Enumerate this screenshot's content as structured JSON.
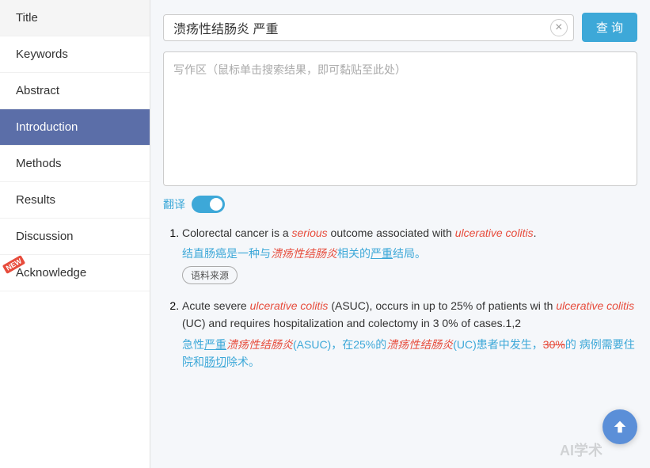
{
  "sidebar": {
    "items": [
      {
        "label": "Title",
        "active": false
      },
      {
        "label": "Keywords",
        "active": false
      },
      {
        "label": "Abstract",
        "active": false
      },
      {
        "label": "Introduction",
        "active": true
      },
      {
        "label": "Methods",
        "active": false
      },
      {
        "label": "Results",
        "active": false
      },
      {
        "label": "Discussion",
        "active": false
      },
      {
        "label": "Acknowledge",
        "active": false,
        "new": true
      }
    ]
  },
  "search": {
    "value": "溃疡性结肠炎 严重",
    "clear_label": "×",
    "button_label": "查 询"
  },
  "writing_area": {
    "placeholder": "写作区（鼠标单击搜索结果，即可黏贴至此处）"
  },
  "translate": {
    "label": "翻译"
  },
  "results": [
    {
      "en": "Colorectal cancer is a serious outcome associated with ulcerative colitis.",
      "en_italic1": "serious",
      "en_italic2": "ulcerative colitis",
      "zh": "结直肠癌是一种与溃疡性结肠炎相关的严重结局。",
      "zh_italic": "溃疡性结肠炎",
      "source": "语料来源"
    },
    {
      "en": "Acute severe ulcerative colitis (ASUC), occurs in up to 25% of patients with ulcerative colitis (UC) and requires hospitalization and colectomy in 30% of cases.1,2",
      "en_italic1": "ulcerative colitis",
      "en_italic2": "ulcerative colitis",
      "zh": "急性严重溃疡性结肠炎(ASUC)，在25%的溃疡性结肠炎(UC)患者中发生，30%的病例需要住院和肠切除术。",
      "source": null
    }
  ],
  "watermark": {
    "text": "AI学术"
  },
  "scroll_up": {
    "label": "↑"
  }
}
